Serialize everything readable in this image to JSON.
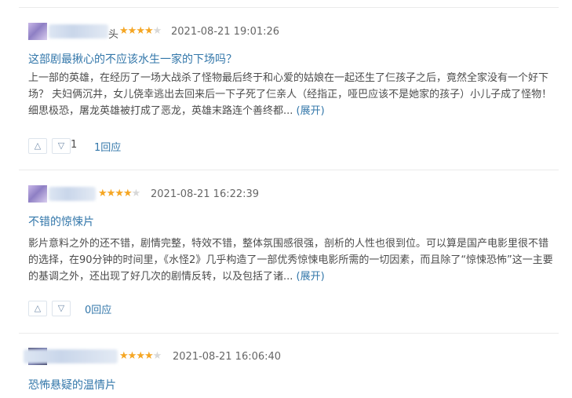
{
  "reviews": [
    {
      "name_suffix": "头",
      "rating": 4,
      "time": "2021-08-21 19:01:26",
      "title": "这部剧最揪心的不应该水生一家的下场吗？",
      "content_lines": [
        "上一部的英雄，在经历了一场大战杀了怪物最后终于和心爱的姑娘在一起还生了仨孩子之后，竟然全家没有一个好下",
        "场？ 夫妇俩沉井，女儿侥幸逃出去回来后一下子死了仨亲人（经指正，哑巴应该不是她家的孩子）小儿子成了怪物！",
        "细思极恐，屠龙英雄被打成了恶龙，英雄末路连个善终都..."
      ],
      "expand": "(展开)",
      "up_icon": "△",
      "down_icon": "▽",
      "useless_count": "1",
      "reply": "1回应"
    },
    {
      "name_suffix": "",
      "rating": 4,
      "time": "2021-08-21 16:22:39",
      "title": "不错的惊悚片",
      "content_lines": [
        "影片意料之外的还不错，剧情完整，特效不错，整体氛围感很强，剖析的人性也很到位。可以算是国产电影里很不错",
        "的选择，在90分钟的时间里，《水怪2》几乎构造了一部优秀惊悚电影所需的一切因素，而且除了“惊悚恐怖”这一主要",
        "的基调之外，还出现了好几次的剧情反转，以及包括了诸..."
      ],
      "expand": "(展开)",
      "up_icon": "△",
      "down_icon": "▽",
      "useless_count": "",
      "reply": "0回应"
    },
    {
      "name_suffix": "",
      "rating": 4,
      "time": "2021-08-21 16:06:40",
      "title": "恐怖悬疑的温情片"
    }
  ],
  "colors": {
    "link": "#3377aa",
    "star": "#f5a623",
    "star_off": "#d8d8d8",
    "divider": "#ebebeb"
  }
}
